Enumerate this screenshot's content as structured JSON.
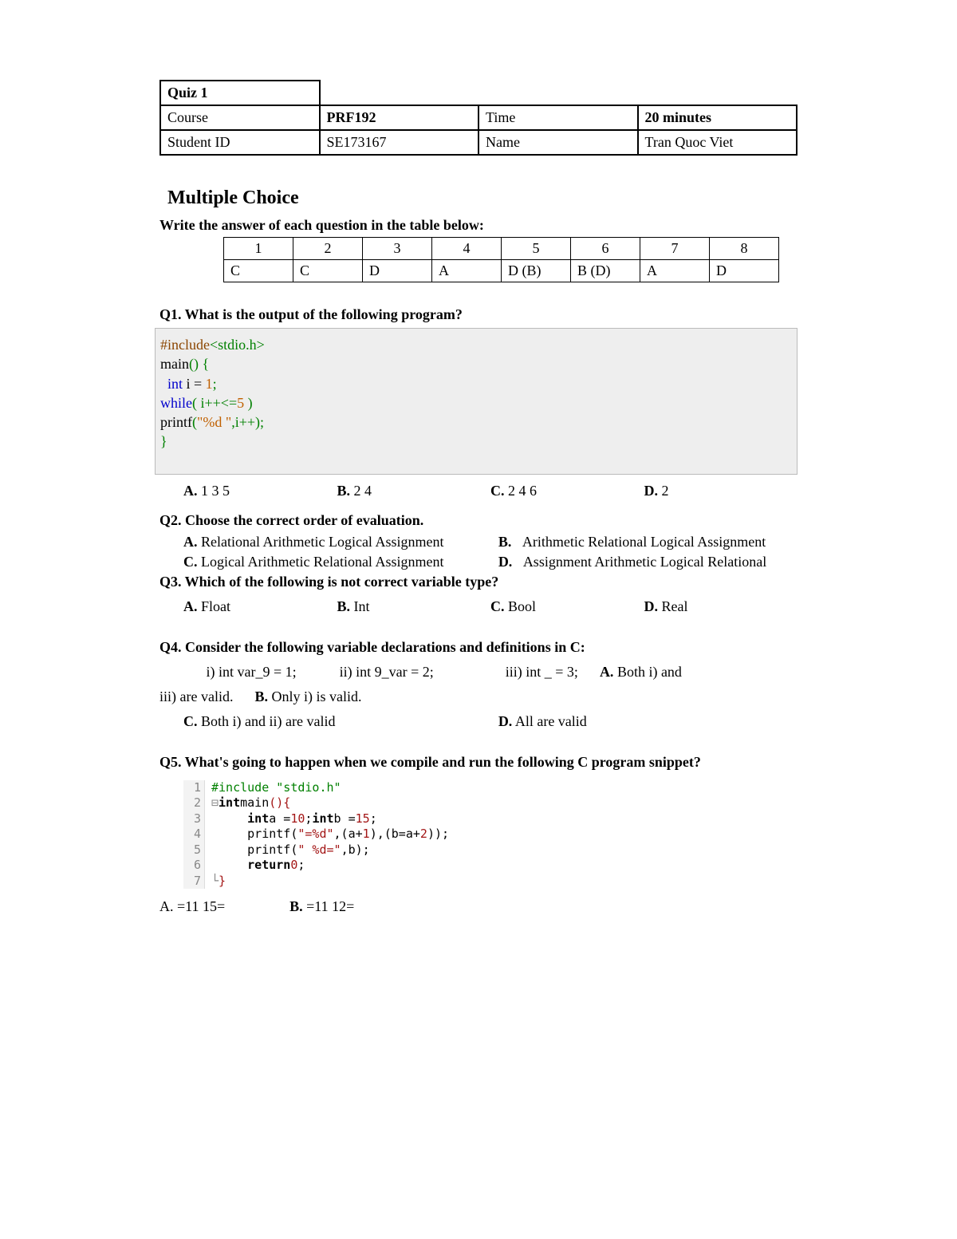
{
  "header": {
    "quiz_label": "Quiz 1",
    "course_lbl": "Course",
    "course_val": "PRF192",
    "time_lbl": "Time",
    "time_val": "20 minutes",
    "sid_lbl": "Student ID",
    "sid_val": "SE173167",
    "name_lbl": "Name",
    "name_val": "Tran Quoc Viet"
  },
  "section_title": "Multiple Choice",
  "instruction": "Write the answer of each question in the table below:",
  "answers": {
    "nums": [
      "1",
      "2",
      "3",
      "4",
      "5",
      "6",
      "7",
      "8"
    ],
    "vals": [
      "C",
      "C",
      "D",
      "A",
      "D (B)",
      "B (D)",
      "A",
      "D"
    ]
  },
  "q1": {
    "title": "Q1. What is the output of the following program?",
    "code": {
      "l1a": "#include",
      "l1b": "<stdio.h>",
      "l2a": "main",
      "l2b": "() {",
      "l3a": "int",
      "l3b": " i = ",
      "l3c": "1",
      "l3d": ";",
      "l4a": "while",
      "l4b": "( i++<=",
      "l4c": "5",
      "l4d": " )",
      "l5a": "printf",
      "l5b": "(",
      "l5c": "\"%d \"",
      "l5d": ",i++);",
      "l6": "}"
    },
    "opts": {
      "a": "1 3 5",
      "b": "2 4",
      "c": "2 4 6",
      "d": "2"
    }
  },
  "q2": {
    "title": "Q2. Choose the correct order of evaluation.",
    "a": "Relational Arithmetic Logical Assignment",
    "b": "Arithmetic Relational Logical Assignment",
    "c": "Logical Arithmetic Relational Assignment",
    "d": "Assignment Arithmetic Logical Relational"
  },
  "q3": {
    "title": "Q3. Which of the following is not correct variable type?",
    "a": "Float",
    "b": "Int",
    "c": "Bool",
    "d": "Real"
  },
  "q4": {
    "title": "Q4. Consider the following variable declarations and definitions in C:",
    "i": "i) int var_9 = 1;",
    "ii": "ii) int 9_var = 2;",
    "iii": "iii) int _ = 3;",
    "a": "Both i) and iii) are valid.",
    "b": "Only i) is valid.",
    "c": "Both i) and ii) are valid",
    "d": "All are valid"
  },
  "q5": {
    "title": "Q5. What's going to happen when we compile and run the following C program snippet?",
    "code": {
      "l1": "#include \"stdio.h\"",
      "l2a": "int",
      "l2b": " main",
      "l2c": "(){",
      "l3a": "int",
      "l3b": " a = ",
      "l3c": "10",
      "l3d": "; ",
      "l3e": "int",
      "l3f": " b = ",
      "l3g": "15",
      "l3h": ";",
      "l4a": "printf(",
      "l4b": "\"=%d\"",
      "l4c": ",(a+",
      "l4d": "1",
      "l4e": "),(b=a+",
      "l4f": "2",
      "l4g": "));",
      "l5a": "printf(",
      "l5b": "\" %d=\"",
      "l5c": ",b);",
      "l6a": "return ",
      "l6b": "0",
      "l6c": ";",
      "l7": "}"
    },
    "a": "=11 15=",
    "b": "=11 12="
  },
  "labels": {
    "A": "A.",
    "B": "B.",
    "C": "C.",
    "D": "D."
  }
}
